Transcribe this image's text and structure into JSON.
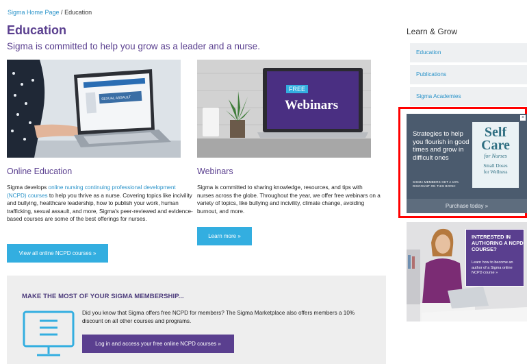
{
  "breadcrumb": {
    "home": "Sigma Home Page",
    "separator": " / ",
    "current": "Education"
  },
  "page": {
    "title": "Education",
    "subtitle": "Sigma is committed to help you grow as a leader and a nurse."
  },
  "online_education": {
    "heading": "Online Education",
    "text_before": "Sigma develops ",
    "link": "online nursing continuing professional development (NCPD) courses",
    "text_after": " to help you thrive as a nurse. Covering topics like incivility and bullying, healthcare leadership, how to publish your work, human trafficking, sexual assault, and more, Sigma's peer-reviewed and evidence-based courses are some of the best offerings for nurses.",
    "button": "View all online NCPD courses »",
    "image_screen_text": "SEXUAL ASSAULT"
  },
  "webinars": {
    "heading": "Webinars",
    "text": "Sigma is committed to sharing knowledge, resources, and tips with nurses across the globe. Throughout the year, we offer free webinars on a variety of topics, like bullying and incivility, climate change, avoiding burnout, and more.",
    "button": "Learn more »",
    "screen_badge": "FREE",
    "screen_title": "Webinars"
  },
  "membership": {
    "title": "MAKE THE MOST OF YOUR SIGMA MEMBERSHIP...",
    "text": "Did you know that Sigma offers free NCPD for members? The Sigma Marketplace also offers members a 10% discount on all other courses and programs.",
    "button": "Log in and access your free online NCPD courses »"
  },
  "sidebar": {
    "title": "Learn & Grow",
    "items": [
      {
        "label": "Education"
      },
      {
        "label": "Publications"
      },
      {
        "label": "Sigma Academies"
      }
    ]
  },
  "ad": {
    "text": "Strategies to help you flourish in good times and grow in difficult ones",
    "small": "SIGMA MEMBERS GET A 10% DISCOUNT ON THIS BOOK!",
    "book_line1": "Self",
    "book_line2": "Care",
    "book_line3": "for Nurses",
    "book_line4": "Small Doses",
    "book_line5": "for Wellness",
    "cta": "Purchase today »",
    "close": "×"
  },
  "promo": {
    "heading": "INTERESTED IN AUTHORING A NCPD COURSE?",
    "body": "Learn how to become an author of a Sigma online NCPD course »"
  },
  "colors": {
    "brand_purple": "#5a3f8f",
    "link_blue": "#2a93c9",
    "button_blue": "#33aee0",
    "highlight_red": "#ff0000"
  }
}
